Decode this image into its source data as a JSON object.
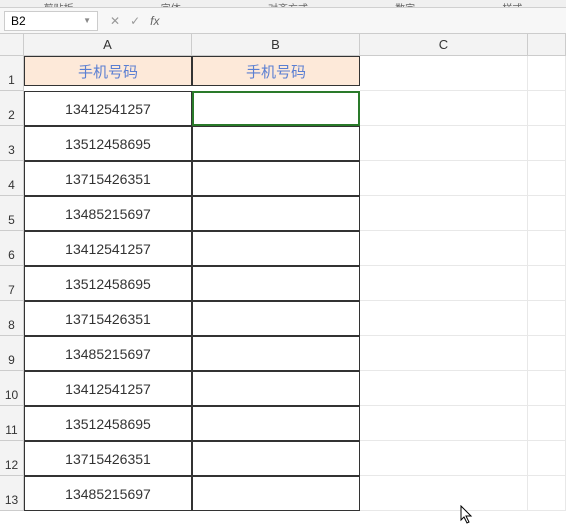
{
  "ribbon_fragments": [
    "剪贴板",
    "字体",
    "对齐方式",
    "数字",
    "样式"
  ],
  "name_box": {
    "value": "B2"
  },
  "fx": {
    "cancel": "✕",
    "enter": "✓",
    "label": "fx"
  },
  "formula_bar": {
    "value": ""
  },
  "columns": [
    "A",
    "B",
    "C",
    ""
  ],
  "chart_data": {
    "type": "table",
    "headers": {
      "A": "手机号码",
      "B": "手机号码"
    },
    "rows": [
      {
        "n": 1,
        "A": "手机号码",
        "B": "手机号码",
        "is_header": true
      },
      {
        "n": 2,
        "A": "13412541257",
        "B": "",
        "selected": true
      },
      {
        "n": 3,
        "A": "13512458695",
        "B": ""
      },
      {
        "n": 4,
        "A": "13715426351",
        "B": ""
      },
      {
        "n": 5,
        "A": "13485215697",
        "B": ""
      },
      {
        "n": 6,
        "A": "13412541257",
        "B": ""
      },
      {
        "n": 7,
        "A": "13512458695",
        "B": ""
      },
      {
        "n": 8,
        "A": "13715426351",
        "B": ""
      },
      {
        "n": 9,
        "A": "13485215697",
        "B": ""
      },
      {
        "n": 10,
        "A": "13412541257",
        "B": ""
      },
      {
        "n": 11,
        "A": "13512458695",
        "B": ""
      },
      {
        "n": 12,
        "A": "13715426351",
        "B": ""
      },
      {
        "n": 13,
        "A": "13485215697",
        "B": ""
      }
    ]
  }
}
